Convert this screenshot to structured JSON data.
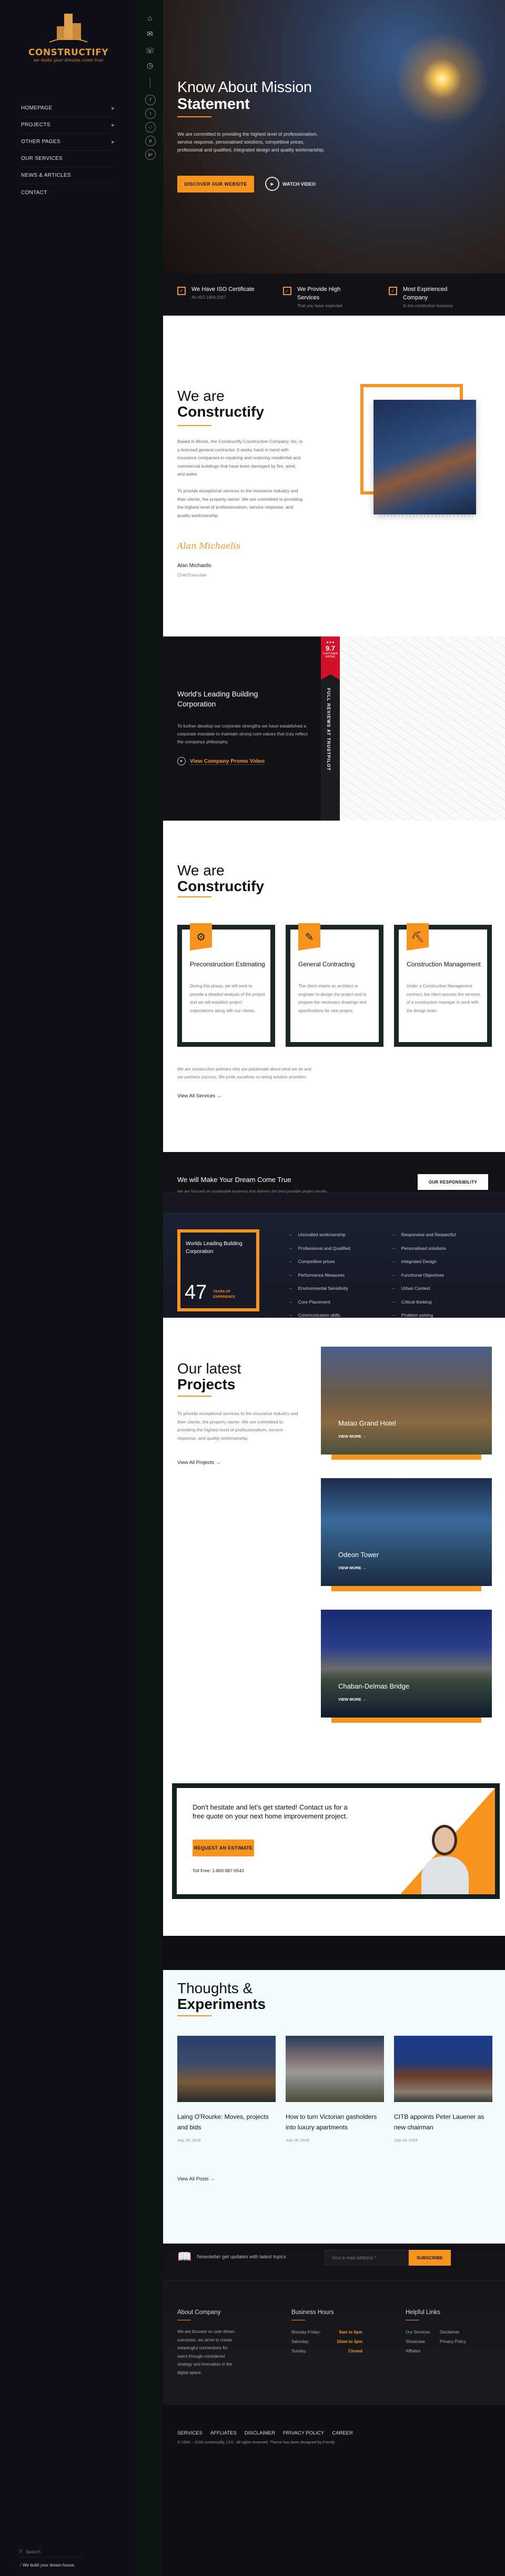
{
  "brand": {
    "name": "CONSTRUCTIFY",
    "tagline": "we make your dreams come true",
    "accent_color": "#f7941d"
  },
  "sidebar": {
    "nav": [
      {
        "label": "HOMEPAGE",
        "has_submenu": true
      },
      {
        "label": "PROJECTS",
        "has_submenu": true
      },
      {
        "label": "OTHER PAGES",
        "has_submenu": true
      },
      {
        "label": "OUR SERVICES",
        "has_submenu": false
      },
      {
        "label": "NEWS & ARTICLES",
        "has_submenu": false
      },
      {
        "label": "CONTACT",
        "has_submenu": false
      }
    ],
    "search_placeholder": "Search",
    "slogan": "We build your dream house."
  },
  "iconbar": {
    "icons": [
      "home-icon",
      "mail-icon",
      "phone-icon",
      "clock-icon"
    ],
    "social": [
      "facebook-icon",
      "twitter-icon",
      "instagram-icon",
      "pinterest-icon",
      "google-plus-icon"
    ]
  },
  "hero": {
    "title_light": "Know About Mission",
    "title_bold": "Statement",
    "text": "We are committed to providing the highest level of professionalism, service response, personalised solutions, competitive prices, professional and qualified, integrated design and quality workmanship.",
    "primary_button": "DISCOVER OUR WEBSITE",
    "video_button": "WATCH VIDEO"
  },
  "features": [
    {
      "title": "We Have ISO Certificate",
      "subtitle": "An ISO 1900:2007"
    },
    {
      "title": "We Provide High Services",
      "subtitle": "That you have expected"
    },
    {
      "title": "Most Expirienced Company",
      "subtitle": "In the constrution business"
    }
  ],
  "about": {
    "title_light": "We are",
    "title_bold": "Constructify",
    "para1": "Based in Illinois, the Constructify Construction Company, Inc. is a licensed general contractor. It works hand in hand with insurance companies in repairing and restoring residential and commercial buildings that have been damaged by fire, wind, and water.",
    "para2": "To provide exceptional services to the insurance industry and thier clients, the property owner. We are committed to providing the highest level of professionalism, service response, and quality workmanship.",
    "signature": "Alan Michaelis",
    "name": "Alan Michaelis",
    "role": "Chief Executive"
  },
  "leading": {
    "title": "World's Leading Building Corporation",
    "text": "To further develop our corporate strengths we have established a corporate mandate to maintain strong core values that truly reflect the companys philosophy.",
    "promo_link": "View Company Promo Video",
    "rating": {
      "stars": "★★★",
      "score": "9.7",
      "label": "CUSTOMER RATING"
    },
    "reviews_label": "FULL REVIEWS AT TRUSTPILOT"
  },
  "services": {
    "title_light": "We are",
    "title_bold": "Constructify",
    "cards": [
      {
        "icon": "head-gear-icon",
        "glyph": "⚙",
        "title": "Preconstruction Estimating",
        "text": "During this phase, we will work to provide a detailed analysis of the project and we will establish project expectations along with our clients."
      },
      {
        "icon": "pencil-ruler-icon",
        "glyph": "✎",
        "title": "General Contracting",
        "text": "The client retains an architect or engineer to design the project and to prepare the necessary drawings and specifications for new project."
      },
      {
        "icon": "crane-icon",
        "glyph": "⛏",
        "title": "Construction Management",
        "text": "Under a Construction Management contract, the client secures the services of a construction manager to work with the design team."
      }
    ],
    "note": "We are construction partners who are passionate about what we do and our partners success. We pride ourselves on being solution providers.",
    "link": "View All Services →"
  },
  "dream": {
    "title": "We will Make Your Dream Come True",
    "text": "We are focused on sustainable business that delivers the best possible project results.",
    "button": "OUR RESPONSIBILITY",
    "experience": {
      "title": "Worlds Leading Building Corporation",
      "years": "47",
      "years_label": "YEARS OF EXPERIENCE"
    },
    "list_left": [
      "Unrivalled workmanship",
      "Professional and Qualified",
      "Competitive prices",
      "Performance Measures",
      "Environmental Sensitivity",
      "Core Placement",
      "Communication skills"
    ],
    "list_right": [
      "Responsive and Respectful",
      "Personalised solutions",
      "Integrated Design",
      "Functional Objectives",
      "Urban Context",
      "Critical thinking",
      "Problem solving"
    ]
  },
  "projects": {
    "title_light": "Our latest",
    "title_bold": "Projects",
    "text": "To provide exceptional services to the insurance industry and thier clients, the property owner. We are committed to providing the highest level of professionalism, service response, and quality workmanship.",
    "link": "View All Projects →",
    "items": [
      {
        "name": "Matao Grand Hotel",
        "cta": "VIEW MORE →"
      },
      {
        "name": "Odeon Tower",
        "cta": "VIEW MORE →"
      },
      {
        "name": "Chaban-Delmas Bridge",
        "cta": "VIEW MORE →"
      }
    ]
  },
  "cta": {
    "text": "Don't hesitate and let's get started! Contact us for a free quote on your next home improvement project.",
    "button": "REQUEST AN ESTIMATE",
    "toll_free": "Toll Free: 1-800-987-6543"
  },
  "blog": {
    "title_light": "Thoughts &",
    "title_bold": "Experiments",
    "posts": [
      {
        "title": "Laing O'Rourke: Moves, projects and bids",
        "date": "July 18, 2018"
      },
      {
        "title": "How to turn Victorian gasholders into luxury apartments",
        "date": "July 18, 2018"
      },
      {
        "title": "CITB appoints Peter Lauener as new chairman",
        "date": "July 18, 2018"
      }
    ],
    "link": "View All Posts →"
  },
  "footer": {
    "newsletter_text": "Newsletter get updates with latest topics",
    "email_placeholder": "Your e-mail address *",
    "subscribe": "SUBSCRIBE",
    "about_title": "About Company",
    "about_text": "We are focused on user-driven outcomes, we strive to create meaningful connections for users through considered strategy and innovation in the digital space.",
    "hours_title": "Business Hours",
    "hours": [
      {
        "day": "Monday-Friday:",
        "time": "9am to 5pm"
      },
      {
        "day": "Saturday:",
        "time": "10am to 3pm"
      },
      {
        "day": "Sunday:",
        "time": "Closed"
      }
    ],
    "links_title": "Helpful Links",
    "links": [
      "Our Services",
      "Disclaimer",
      "Showcase",
      "Privacy Policy",
      "Affliates"
    ],
    "bottom_nav": [
      "SERVICES",
      "AFFLIATES",
      "DISCLAIMER",
      "PRIVACY POLICY",
      "CAREER"
    ],
    "copyright": "© 1934 – 2018 constructify, LCC. All rights reserved. Theme has been designed by Frenify"
  }
}
